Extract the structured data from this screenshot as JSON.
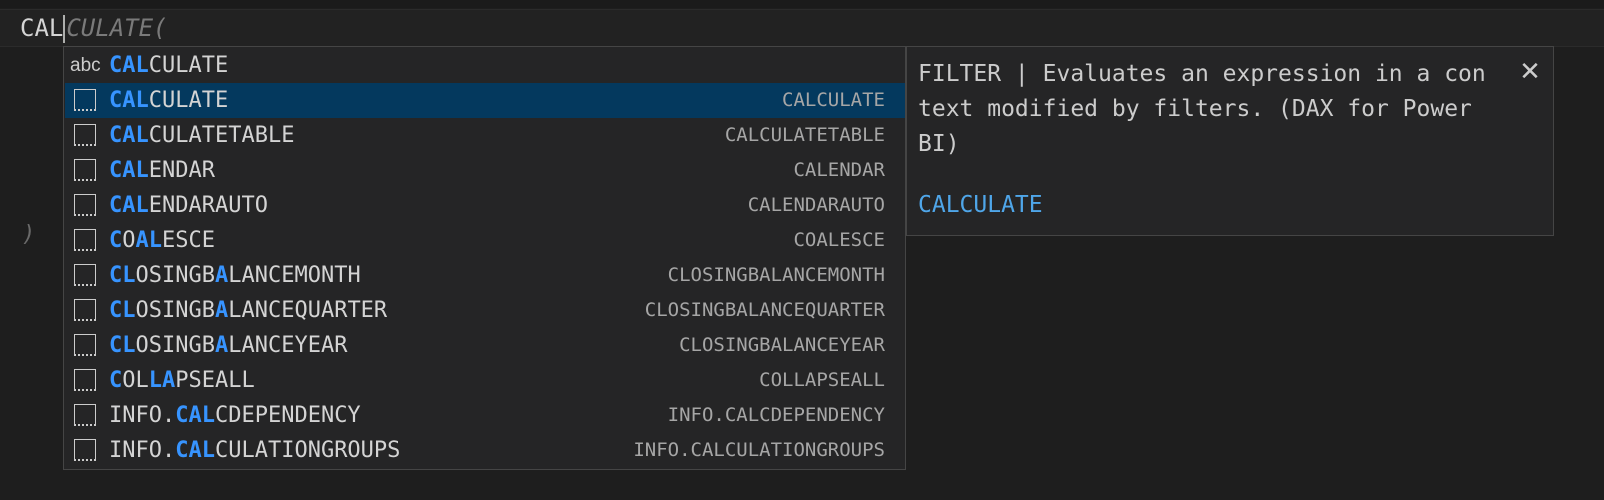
{
  "editor": {
    "typed": "CAL",
    "ghost": "CULATE(",
    "closing_paren": ")"
  },
  "suggest": {
    "items": [
      {
        "kind": "abc",
        "pre": "",
        "match1": "CAL",
        "mid": "CULATE",
        "match2": "",
        "post": "",
        "detail": ""
      },
      {
        "kind": "function",
        "pre": "",
        "match1": "CAL",
        "mid": "CULATE",
        "match2": "",
        "post": "",
        "detail": "CALCULATE"
      },
      {
        "kind": "function",
        "pre": "",
        "match1": "CAL",
        "mid": "CULATETABLE",
        "match2": "",
        "post": "",
        "detail": "CALCULATETABLE"
      },
      {
        "kind": "function",
        "pre": "",
        "match1": "CAL",
        "mid": "ENDAR",
        "match2": "",
        "post": "",
        "detail": "CALENDAR"
      },
      {
        "kind": "function",
        "pre": "",
        "match1": "CAL",
        "mid": "ENDARAUTO",
        "match2": "",
        "post": "",
        "detail": "CALENDARAUTO"
      },
      {
        "kind": "function",
        "pre": "",
        "match1": "C",
        "mid": "O",
        "match2": "AL",
        "post": "ESCE",
        "detail": "COALESCE"
      },
      {
        "kind": "function",
        "pre": "",
        "match1": "CL",
        "mid": "OSINGB",
        "match2": "A",
        "post": "LANCEMONTH",
        "detail": "CLOSINGBALANCEMONTH"
      },
      {
        "kind": "function",
        "pre": "",
        "match1": "CL",
        "mid": "OSINGB",
        "match2": "A",
        "post": "LANCEQUARTER",
        "detail": "CLOSINGBALANCEQUARTER"
      },
      {
        "kind": "function",
        "pre": "",
        "match1": "CL",
        "mid": "OSINGB",
        "match2": "A",
        "post": "LANCEYEAR",
        "detail": "CLOSINGBALANCEYEAR"
      },
      {
        "kind": "function",
        "pre": "",
        "match1": "C",
        "mid": "OL",
        "match2": "LA",
        "post": "PSEALL",
        "detail": "COLLAPSEALL"
      },
      {
        "kind": "function",
        "pre": "INFO.",
        "match1": "CAL",
        "mid": "CDEPENDENCY",
        "match2": "",
        "post": "",
        "detail": "INFO.CALCDEPENDENCY"
      },
      {
        "kind": "function",
        "pre": "INFO.",
        "match1": "CAL",
        "mid": "CULATIONGROUPS",
        "match2": "",
        "post": "",
        "detail": "INFO.CALCULATIONGROUPS"
      }
    ],
    "selected_index": 1
  },
  "details": {
    "text": "FILTER | Evaluates an expression in a con\ntext modified by filters. (DAX for Power\nBI)",
    "link": "CALCULATE",
    "close_icon": "close-icon"
  },
  "colors": {
    "background": "#1e1e1e",
    "widget": "#252526",
    "selected_row": "#04395e",
    "match_highlight": "#3794ff",
    "link": "#4fa6e9"
  }
}
